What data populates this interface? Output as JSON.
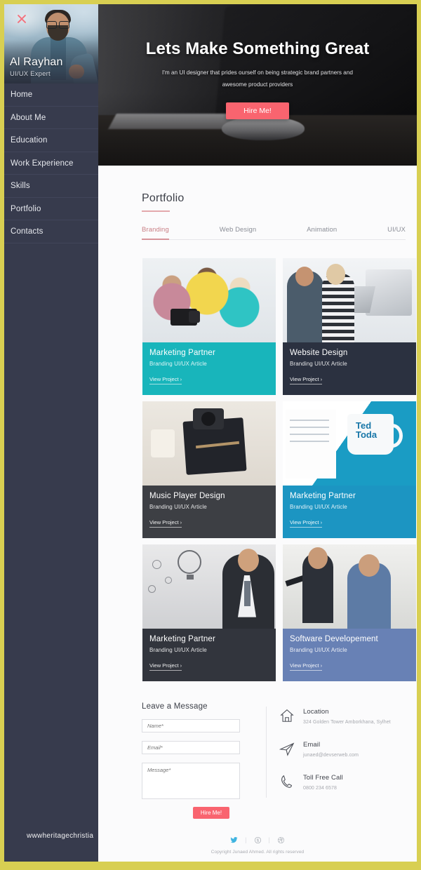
{
  "sidebar": {
    "close_icon": "close-icon",
    "profile": {
      "name": "Al Rayhan",
      "role": "UI/UX Expert"
    },
    "nav": [
      {
        "label": "Home"
      },
      {
        "label": "About Me"
      },
      {
        "label": "Education"
      },
      {
        "label": "Work Experience"
      },
      {
        "label": "Skills"
      },
      {
        "label": "Portfolio"
      },
      {
        "label": "Contacts"
      }
    ]
  },
  "hero": {
    "title": "Lets Make Something Great",
    "subtitle": "I'm an UI designer that prides ourself on being strategic brand partners and awesome product providers",
    "cta": "Hire Me!"
  },
  "portfolio": {
    "title": "Portfolio",
    "tabs": [
      {
        "label": "Branding",
        "active": true
      },
      {
        "label": "Web Design",
        "active": false
      },
      {
        "label": "Animation",
        "active": false
      },
      {
        "label": "UI/UX",
        "active": false
      }
    ],
    "link_label": "View Project ›",
    "cards": [
      {
        "title": "Marketing Partner",
        "subtitle": "Branding UI/UX Article",
        "color": "#18b5bb"
      },
      {
        "title": "Website Design",
        "subtitle": "Branding UI/UX Article",
        "color": "#2b3140"
      },
      {
        "title": "Music Player Design",
        "subtitle": "Branding UI/UX Article",
        "color": "#3d3f44"
      },
      {
        "title": "Marketing Partner",
        "subtitle": "Branding UI/UX Article",
        "color": "#1c95c2"
      },
      {
        "title": "Marketing Partner",
        "subtitle": "Branding UI/UX Article",
        "color": "#32353d"
      },
      {
        "title": "Software Developement",
        "subtitle": "Branding UI/UX Article",
        "color": "#6881b5"
      }
    ]
  },
  "contact": {
    "form_title": "Leave a Message",
    "name_placeholder": "Name*",
    "email_placeholder": "Email*",
    "message_placeholder": "Message*",
    "submit_label": "Hire Me!",
    "info": [
      {
        "icon": "home-icon",
        "label": "Location",
        "value": "324 Golden Tower Amborkhana, Sylhet"
      },
      {
        "icon": "send-icon",
        "label": "Email",
        "value": "junaed@devserweb.com"
      },
      {
        "icon": "phone-icon",
        "label": "Toll Free Call",
        "value": "0800 234 6578"
      }
    ]
  },
  "footer": {
    "social": [
      "twitter-icon",
      "skype-icon",
      "dribbble-icon"
    ],
    "copyright": "Copyright Junaed Ahmed. All rights reserved"
  },
  "watermark": "wwwheritagechristia",
  "colors": {
    "accent_pink": "#f9646f",
    "sidebar_bg": "#373b4d",
    "frame": "#d8cf52",
    "rule": "#e3a8ac"
  }
}
